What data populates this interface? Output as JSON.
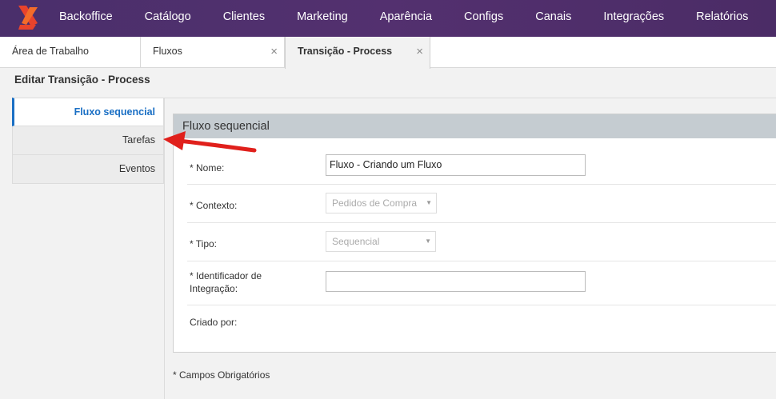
{
  "nav": {
    "items": [
      "Backoffice",
      "Catálogo",
      "Clientes",
      "Marketing",
      "Aparência",
      "Configs",
      "Canais",
      "Integrações",
      "Relatórios"
    ]
  },
  "tabs": [
    {
      "label": "Área de Trabalho",
      "closable": false
    },
    {
      "label": "Fluxos",
      "closable": true
    },
    {
      "label": "Transição - Process",
      "closable": true
    }
  ],
  "close_glyph": "×",
  "page_title": "Editar Transição - Process",
  "sidemenu": {
    "items": [
      "Fluxo sequencial",
      "Tarefas",
      "Eventos"
    ],
    "active": "Fluxo sequencial"
  },
  "form": {
    "title": "Fluxo sequencial",
    "nome": {
      "label": "* Nome:",
      "value": "Fluxo - Criando um Fluxo"
    },
    "contexto": {
      "label": "* Contexto:",
      "value": "Pedidos de Compra"
    },
    "tipo": {
      "label": "* Tipo:",
      "value": "Sequencial"
    },
    "identificador": {
      "label_line1": "* Identificador de",
      "label_line2": "Integração:",
      "value": ""
    },
    "criado_por": {
      "label": "Criado por:"
    }
  },
  "footnote": "* Campos Obrigatórios",
  "colors": {
    "nav_bg": "#4f2f6c",
    "logo_orange": "#e8432c",
    "active_blue": "#1a6fc4",
    "panel_head": "#c5ccd1",
    "annotation_arrow": "#e0201c"
  },
  "icons": {
    "logo": "brand-logo-icon",
    "close": "close-icon",
    "select_arrow": "caret-down-icon",
    "annotation": "red-arrow-pointer"
  }
}
